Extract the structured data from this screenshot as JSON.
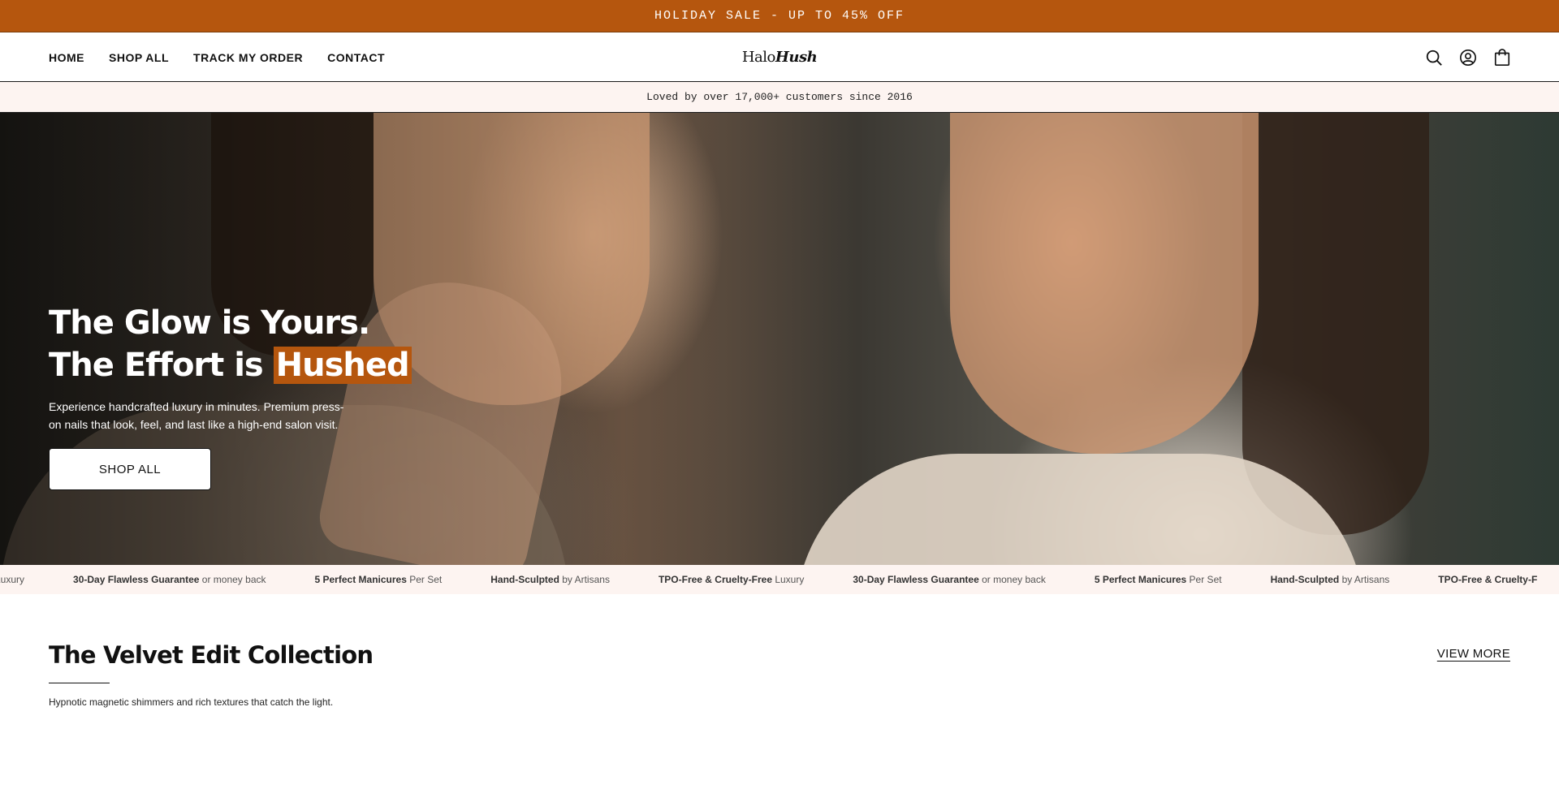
{
  "promo": {
    "text": "HOLIDAY SALE - UP TO 45% OFF"
  },
  "nav": {
    "items": [
      {
        "label": "HOME"
      },
      {
        "label": "SHOP ALL"
      },
      {
        "label": "TRACK MY ORDER"
      },
      {
        "label": "CONTACT"
      }
    ]
  },
  "logo": {
    "part1": "Halo",
    "part2": "Hush"
  },
  "header_icons": [
    "search-icon",
    "account-icon",
    "bag-icon"
  ],
  "trust": {
    "text": "Loved by over 17,000+ customers since 2016"
  },
  "hero": {
    "title_line1": "The Glow is Yours.",
    "title_line2_prefix": "The Effort is ",
    "title_highlight": "Hushed",
    "subtitle": "Experience handcrafted luxury in minutes. Premium press-on nails that look, feel, and last like a high-end salon visit.",
    "button_label": "SHOP ALL"
  },
  "marquee": {
    "items": [
      {
        "bold": "",
        "rest": "lty-Free Luxury"
      },
      {
        "bold": "30-Day Flawless Guarantee",
        "rest": " or money back"
      },
      {
        "bold": "5 Perfect Manicures",
        "rest": " Per Set"
      },
      {
        "bold": "Hand-Sculpted",
        "rest": " by Artisans"
      },
      {
        "bold": "TPO-Free & Cruelty-Free",
        "rest": " Luxury"
      },
      {
        "bold": "30-Day Flawless Guarantee",
        "rest": " or money back"
      },
      {
        "bold": "5 Perfect Manicures",
        "rest": " Per Set"
      },
      {
        "bold": "Hand-Sculpted",
        "rest": " by Artisans"
      },
      {
        "bold": "TPO-Free & Cruelty-F",
        "rest": ""
      }
    ]
  },
  "collection": {
    "title": "The Velvet Edit Collection",
    "description": "Hypnotic magnetic shimmers and rich textures that catch the light.",
    "view_more": "VIEW MORE"
  },
  "colors": {
    "accent": "#b5560e",
    "trust_bg": "#fdf4f1"
  }
}
